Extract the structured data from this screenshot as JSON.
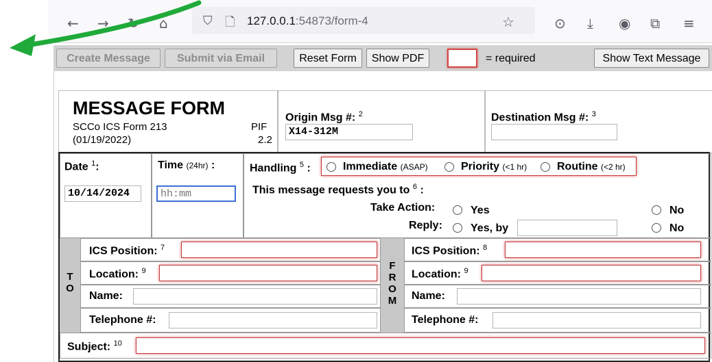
{
  "browser": {
    "url_host": "127.0.0.1",
    "url_rest": ":54873/form-4",
    "icons": [
      "back-icon",
      "forward-icon",
      "reload-icon",
      "home-icon",
      "shield-icon",
      "page-icon",
      "star-icon",
      "pocket-icon",
      "download-icon",
      "account-icon",
      "extensions-icon",
      "menu-icon"
    ]
  },
  "toolbar": {
    "create_label": "Create Message",
    "submit_label": "Submit via Email",
    "reset_label": "Reset Form",
    "pdf_label": "Show PDF",
    "required_text": "= required",
    "show_text_label": "Show Text Message"
  },
  "form": {
    "title": "MESSAGE FORM",
    "subtitle": "SCCo ICS Form 213",
    "date_rev": "(01/19/2022)",
    "pif_label": "PIF",
    "pif_value": "2.2",
    "origin_label": "Origin Msg #:",
    "origin_num": "2",
    "origin_value": "X14-312M",
    "dest_label": "Destination Msg #:",
    "dest_num": "3",
    "date_label": "Date",
    "date_num": "1",
    "date_colon": ":",
    "date_value": "10/14/2024",
    "time_label": "Time",
    "time_note": "(24hr)",
    "time_colon": ":",
    "time_placeholder": "hh:mm",
    "handling_label": "Handling",
    "handling_num": "5",
    "handling_colon": ":",
    "immediate": "Immediate",
    "immediate_note": "(ASAP)",
    "priority": "Priority",
    "priority_note": "(<1 hr)",
    "routine": "Routine",
    "routine_note": "(<2 hr)",
    "requests_label": "This message requests you to",
    "requests_num": "6",
    "requests_colon": ":",
    "take_action": "Take Action:",
    "yes": "Yes",
    "no": "No",
    "reply": "Reply:",
    "yes_by": "Yes, by",
    "no2": "No",
    "to_letters": [
      "T",
      "O"
    ],
    "from_letters": [
      "F",
      "R",
      "O",
      "M"
    ],
    "to_ics_label": "ICS Position:",
    "to_ics_num": "7",
    "to_loc_label": "Location:",
    "to_loc_num": "9",
    "to_name_label": "Name:",
    "to_tel_label": "Telephone #:",
    "from_ics_label": "ICS Position:",
    "from_ics_num": "8",
    "from_loc_label": "Location:",
    "from_loc_num": "9",
    "from_name_label": "Name:",
    "from_tel_label": "Telephone #:",
    "subject_label": "Subject:",
    "subject_num": "10"
  },
  "colors": {
    "required_border": "#c23b3b",
    "toolbar_bg": "#d3d3d3",
    "arrow": "#1faa3a"
  }
}
